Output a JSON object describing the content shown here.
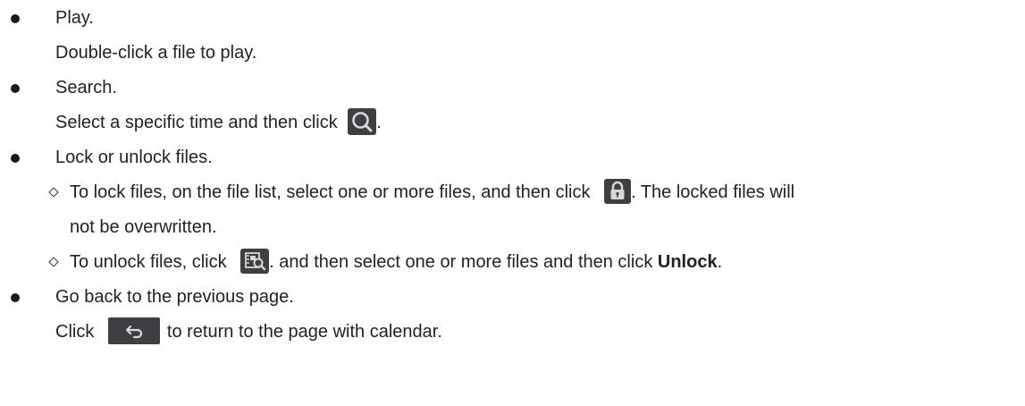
{
  "items": [
    {
      "title": "Play.",
      "detail": "Double-click a file to play."
    },
    {
      "title": "Search.",
      "detail_before": "Select a specific time and then click",
      "detail_after": ".",
      "icon": "search-icon"
    },
    {
      "title": "Lock or unlock files.",
      "sub": [
        {
          "before": "To lock files, on the file list, select one or more files, and then click",
          "after": ". The locked files will",
          "cont": "not be overwritten.",
          "icon": "lock-icon"
        },
        {
          "before": "To unlock files, click",
          "after": ". and then select one or more files and then click",
          "bold": "Unlock",
          "end": ".",
          "icon": "locked-files-search-icon"
        }
      ]
    },
    {
      "title": "Go back to the previous page.",
      "detail_before": "Click",
      "detail_after": "to return to the page with calendar.",
      "icon": "back-arrow-icon"
    }
  ],
  "colors": {
    "icon_bg": "#3d3f43",
    "icon_fg": "#d8d8d8",
    "text": "#222222"
  }
}
